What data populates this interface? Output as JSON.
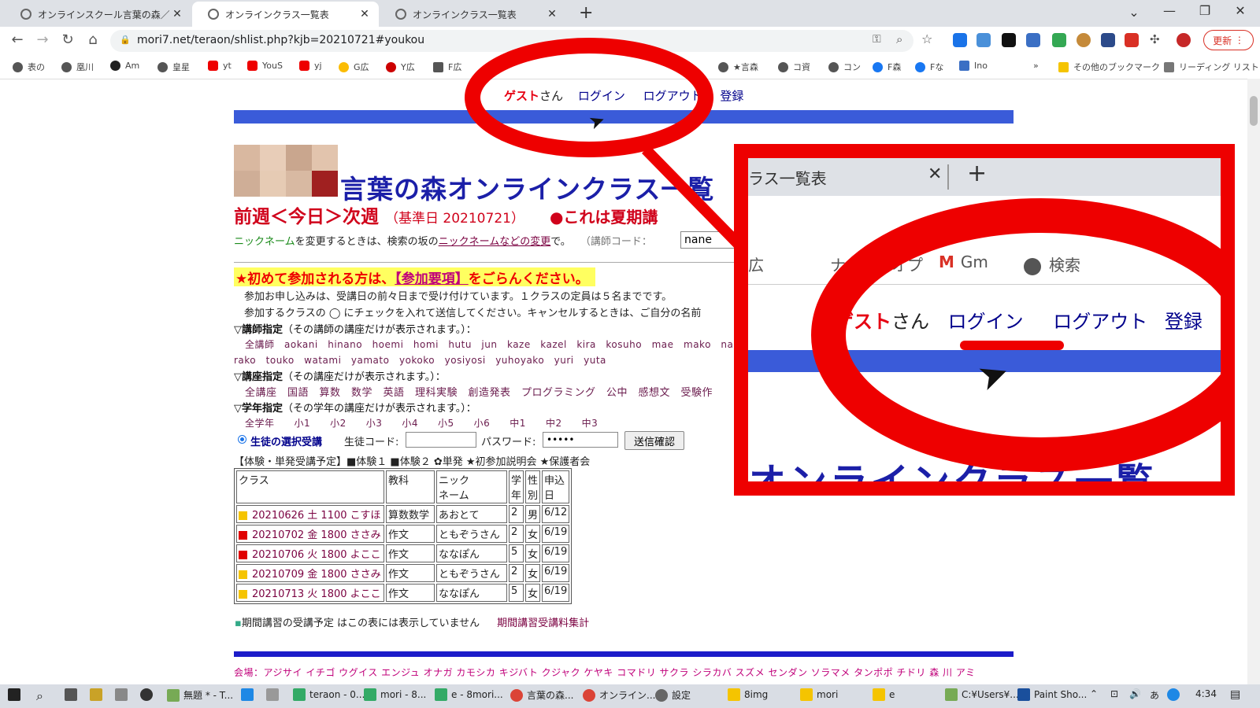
{
  "browser": {
    "tabs": [
      {
        "title": "オンラインスクール言葉の森／公式ホ",
        "close": "✕"
      },
      {
        "title": "オンラインクラス一覧表",
        "close": "✕"
      },
      {
        "title": "オンラインクラス一覧表",
        "close": "✕"
      }
    ],
    "new_tab": "+",
    "url": "mori7.net/teraon/shlist.php?kjb=20210721#youkou",
    "update_button": "更新",
    "bookmarks": [
      "表の",
      "凰川",
      "Am",
      "皇星",
      "yt",
      "YouS",
      "yj",
      "G広",
      "Y広",
      "F広",
      "ナ",
      "オプ",
      "Gm",
      "検索",
      "★言森",
      "コ資",
      "コン",
      "F森",
      "Fな",
      "Ino"
    ],
    "other_bookmarks": "その他のブックマーク",
    "reading_list": "リーディング リスト"
  },
  "page": {
    "guest": "ゲスト",
    "san": "さん",
    "login": "ログイン",
    "logout": "ログアウト",
    "register": "登録",
    "title": "言葉の森オンラインクラス一覧",
    "week_nav": "前週＜今日＞次週",
    "base_date": "（基準日 20210721）",
    "summer": "●これは夏期講",
    "nickname_link": "ニックネーム",
    "nickname_text": "を変更するときは、検索の坂の",
    "nickname_change": "ニックネームなどの変更",
    "nickname_end": "で。",
    "teacher_code_label": "（講師コード：",
    "teacher_code_value": "nane",
    "notice_prefix": "★初めて参加される方は、",
    "notice_link": "【参加要項】",
    "notice_suffix": "をごらんください。",
    "line_apply": "参加お申し込みは、受講日の前々日まで受け付けています。１クラスの定員は５名までです。",
    "line_check": "参加するクラスの ◯ にチェックを入れて送信してください。キャンセルするときは、ご自分の名前",
    "teacher_heading": "▽講師指定",
    "teacher_note": "（その講師の講座だけが表示されます。）：",
    "teachers_row1": "全講師　aokani　hinano　hoemi　homi　hutu　jun　kaze　kazel　kira　kosuho　mae　mako　nan",
    "teachers_row2": "rako　touko　watami　yamato　yokoko　yosiyosi　yuhoyako　yuri　yuta",
    "course_heading": "▽講座指定",
    "course_note": "（その講座だけが表示されます。）：",
    "courses": "全講座　国語　算数　数学　英語　理科実験　創造発表　プログラミング　公中　感想文　受験作",
    "grade_heading": "▽学年指定",
    "grade_note": "（その学年の講座だけが表示されます。）：",
    "grades": "全学年　　小1　　小2　　小3　　小4　　小5　　小6　　中1　　中2　　中3",
    "student_select": "生徒の選択受講",
    "student_code_label": "生徒コード:",
    "password_label": "パスワード:",
    "password_value": "•••••",
    "send_button": "送信確認",
    "legend": "【体験・単発受講予定】■体験１ ■体験２ ✿単発 ★初参加説明会 ★保護者会",
    "table_headers": [
      "クラス",
      "教科",
      "ニック\nネーム",
      "学\n年",
      "性\n別",
      "申込\n日"
    ],
    "rows": [
      {
        "color": "#f5c400",
        "class": "20210626 土 1100 こすほ",
        "subject": "算数数学",
        "nick": "あおとて",
        "grade": "2",
        "sex": "男",
        "date": "6/12"
      },
      {
        "color": "#e00000",
        "class": "20210702 金 1800 ささみ",
        "subject": "作文",
        "nick": "ともぞうさん",
        "grade": "2",
        "sex": "女",
        "date": "6/19"
      },
      {
        "color": "#e00000",
        "class": "20210706 火 1800 よここ",
        "subject": "作文",
        "nick": "ななぽん",
        "grade": "5",
        "sex": "女",
        "date": "6/19"
      },
      {
        "color": "#f5c400",
        "class": "20210709 金 1800 ささみ",
        "subject": "作文",
        "nick": "ともぞうさん",
        "grade": "2",
        "sex": "女",
        "date": "6/19"
      },
      {
        "color": "#f5c400",
        "class": "20210713 火 1800 よここ",
        "subject": "作文",
        "nick": "ななぽん",
        "grade": "5",
        "sex": "女",
        "date": "6/19"
      }
    ],
    "period_note": "期間講習の受講予定 はこの表には表示していません",
    "period_link": "期間講習受講料集計",
    "venue": "会場：アジサイ イチゴ ウグイス エンジュ オナガ カモシカ キジバト クジャク ケヤキ コマドリ サクラ シラカバ スズメ センダン ソラマメ タンポポ チドリ 森 川 アミ"
  },
  "zoom": {
    "tab_fragment": "ラス一覧表",
    "close": "✕",
    "plus": "+",
    "bm_fragments": [
      "広",
      "ナ",
      "オプ",
      "Gm",
      "検索"
    ],
    "guest": "ゲスト",
    "san": "さん",
    "login": "ログイン",
    "logout": "ログアウト",
    "register_fragment": "登録",
    "title_fragment": "オンラインクラス一覧"
  },
  "taskbar": {
    "items": [
      "無題 * - T...",
      "teraon - 0...",
      "mori - 8...",
      "e - 8mori...",
      "言葉の森...",
      "オンライン...",
      "設定",
      "8img",
      "mori",
      "e",
      "C:¥Users¥...",
      "Paint Sho..."
    ],
    "clock": "4:34"
  },
  "colors": {
    "accent_red": "#e60012",
    "title_navy": "#1b1fa8",
    "bar_blue": "#3a5bd9"
  }
}
